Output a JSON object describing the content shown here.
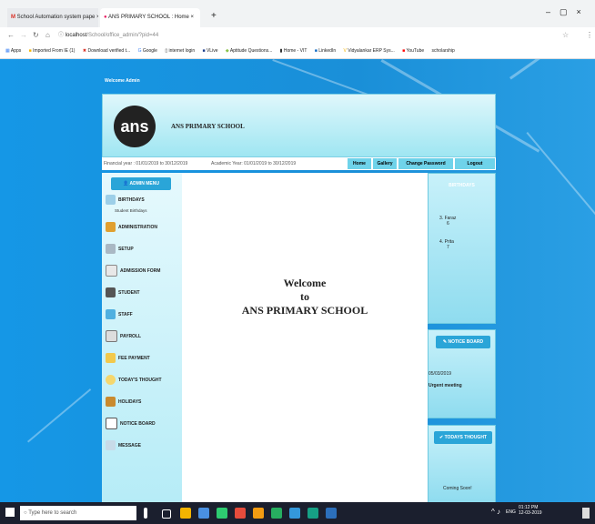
{
  "browser": {
    "tabs": [
      {
        "title": "School Automation system pape",
        "active": false
      },
      {
        "title": "ANS PRIMARY SCHOOL : Home",
        "active": true
      }
    ],
    "address": {
      "host": "localhost",
      "path": "/School/office_admin/?pid=44"
    },
    "bookmarks": [
      "Apps",
      "Imported From IE (1)",
      "Download verified t...",
      "Google",
      "internet login",
      "VLive",
      "Aptitude Questions...",
      "Home - VIT",
      "LinkedIn",
      "Vidyalankar ERP Sys...",
      "YouTube",
      "scholarship"
    ]
  },
  "page": {
    "welcome_admin": "Welcome Admin",
    "logo_text": "ans",
    "school_name": "ANS PRIMARY SCHOOL",
    "financial_year": "Financial year : 01/01/2019 to 30/12/2019",
    "academic_year": "Academic Year: 01/01/2019 to 30/12/2019",
    "nav": [
      "Home",
      "Gallery",
      "Change Password",
      "Logout"
    ],
    "admin_menu": "ADMIN MENU",
    "menu": [
      "BIRTHDAYS",
      "ADMINISTRATION",
      "SETUP",
      "ADMISSION FORM",
      "STUDENT",
      "STAFF",
      "PAYROLL",
      "FEE PAYMENT",
      "TODAY'S THOUGHT",
      "HOLIDAYS",
      "NOTICE BOARD",
      "MESSAGE"
    ],
    "submenu_birthdays": "Student Birthdays",
    "welcome_lines": [
      "Welcome",
      "to",
      "ANS PRIMARY SCHOOL"
    ],
    "birthdays_title": "BIRTHDAYS",
    "birthdays": [
      {
        "num": "3.",
        "name": "Faraz",
        "extra": "6"
      },
      {
        "num": "4.",
        "name": "Prita",
        "extra": "7"
      }
    ],
    "notice_title": "NOTICE BOARD",
    "notice_date": "05/03/2019",
    "notice_text": "Urgent meeting",
    "thought_title": "TODAYS THOUGHT",
    "thought_text": "Coming Soon!"
  },
  "taskbar": {
    "search_placeholder": "Type here to search",
    "lang": "ENG",
    "time": "01:12 PM",
    "date": "12-03-2019"
  }
}
